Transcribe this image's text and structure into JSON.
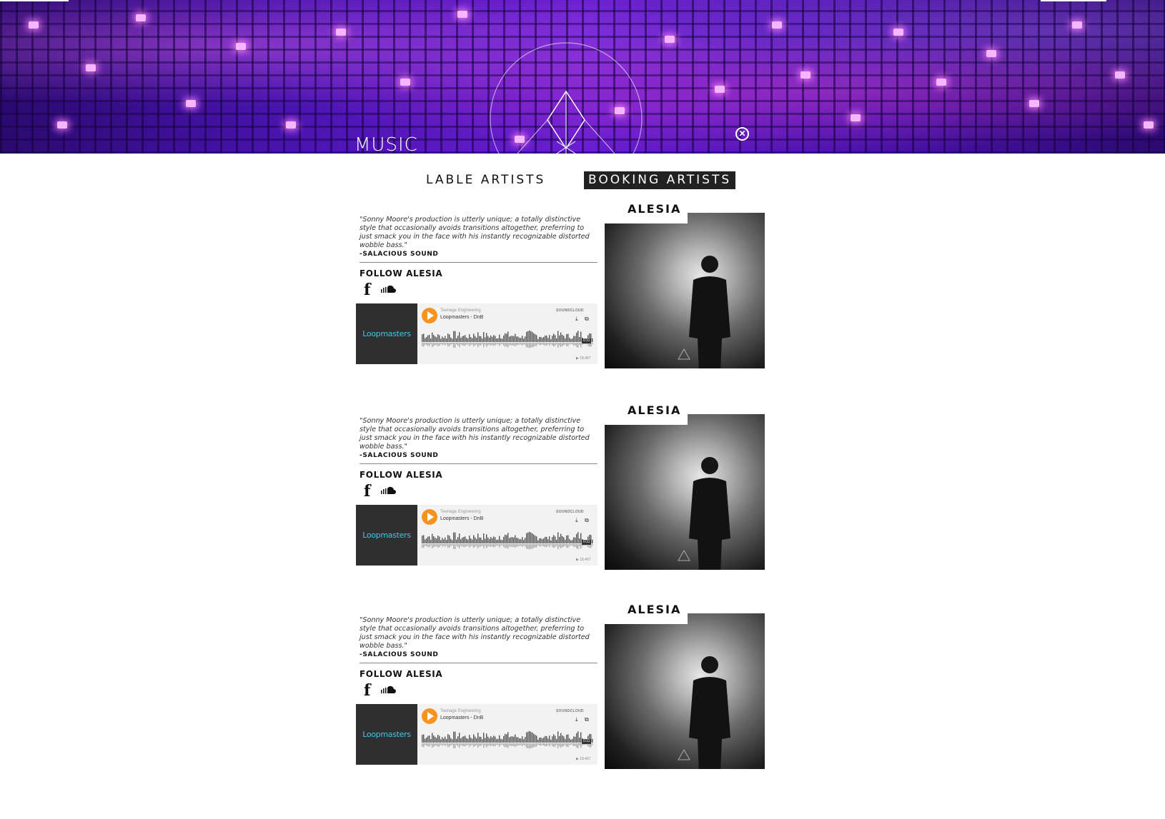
{
  "hero": {
    "title": "MUSIC",
    "close_label": "✕"
  },
  "tabs": [
    {
      "label": "LABLE ARTISTS",
      "active": false
    },
    {
      "label": "BOOKING ARTISTS",
      "active": true
    }
  ],
  "artists": [
    {
      "name": "ALESIA",
      "quote": "\"Sonny Moore's production is utterly unique; a totally distinctive style that occasionally avoids transitions altogether, preferring to just smack you in the face with his instantly recognizable distorted wobble bass.\"",
      "quote_source": "-SALACIOUS SOUND",
      "follow_label": "FOLLOW ALESIA",
      "facebook_icon": "f",
      "player": {
        "art_text": "Loopmasters",
        "user": "Teenage Engineering",
        "title": "Loopmasters - DnB",
        "brand": "SOUNDCLOUD",
        "time": "0:11",
        "plays": "▶ 18,467",
        "download_icon": "⤓",
        "share_icon": "⧉"
      }
    },
    {
      "name": "ALESIA",
      "quote": "\"Sonny Moore's production is utterly unique; a totally distinctive style that occasionally avoids transitions altogether, preferring to just smack you in the face with his instantly recognizable distorted wobble bass.\"",
      "quote_source": "-SALACIOUS SOUND",
      "follow_label": "FOLLOW ALESIA",
      "facebook_icon": "f",
      "player": {
        "art_text": "Loopmasters",
        "user": "Teenage Engineering",
        "title": "Loopmasters - DnB",
        "brand": "SOUNDCLOUD",
        "time": "0:11",
        "plays": "▶ 18,467",
        "download_icon": "⤓",
        "share_icon": "⧉"
      }
    },
    {
      "name": "ALESIA",
      "quote": "\"Sonny Moore's production is utterly unique; a totally distinctive style that occasionally avoids transitions altogether, preferring to just smack you in the face with his instantly recognizable distorted wobble bass.\"",
      "quote_source": "-SALACIOUS SOUND",
      "follow_label": "FOLLOW ALESIA",
      "facebook_icon": "f",
      "player": {
        "art_text": "Loopmasters",
        "user": "Teenage Engineering",
        "title": "Loopmasters - DnB",
        "brand": "SOUNDCLOUD",
        "time": "0:11",
        "plays": "▶ 18,467",
        "download_icon": "⤓",
        "share_icon": "⧉"
      }
    }
  ],
  "colors": {
    "hero_purple": "#4a14b0",
    "accent_orange": "#f7931e",
    "tab_active_bg": "#222222",
    "loop_cyan": "#3fc8e6"
  }
}
